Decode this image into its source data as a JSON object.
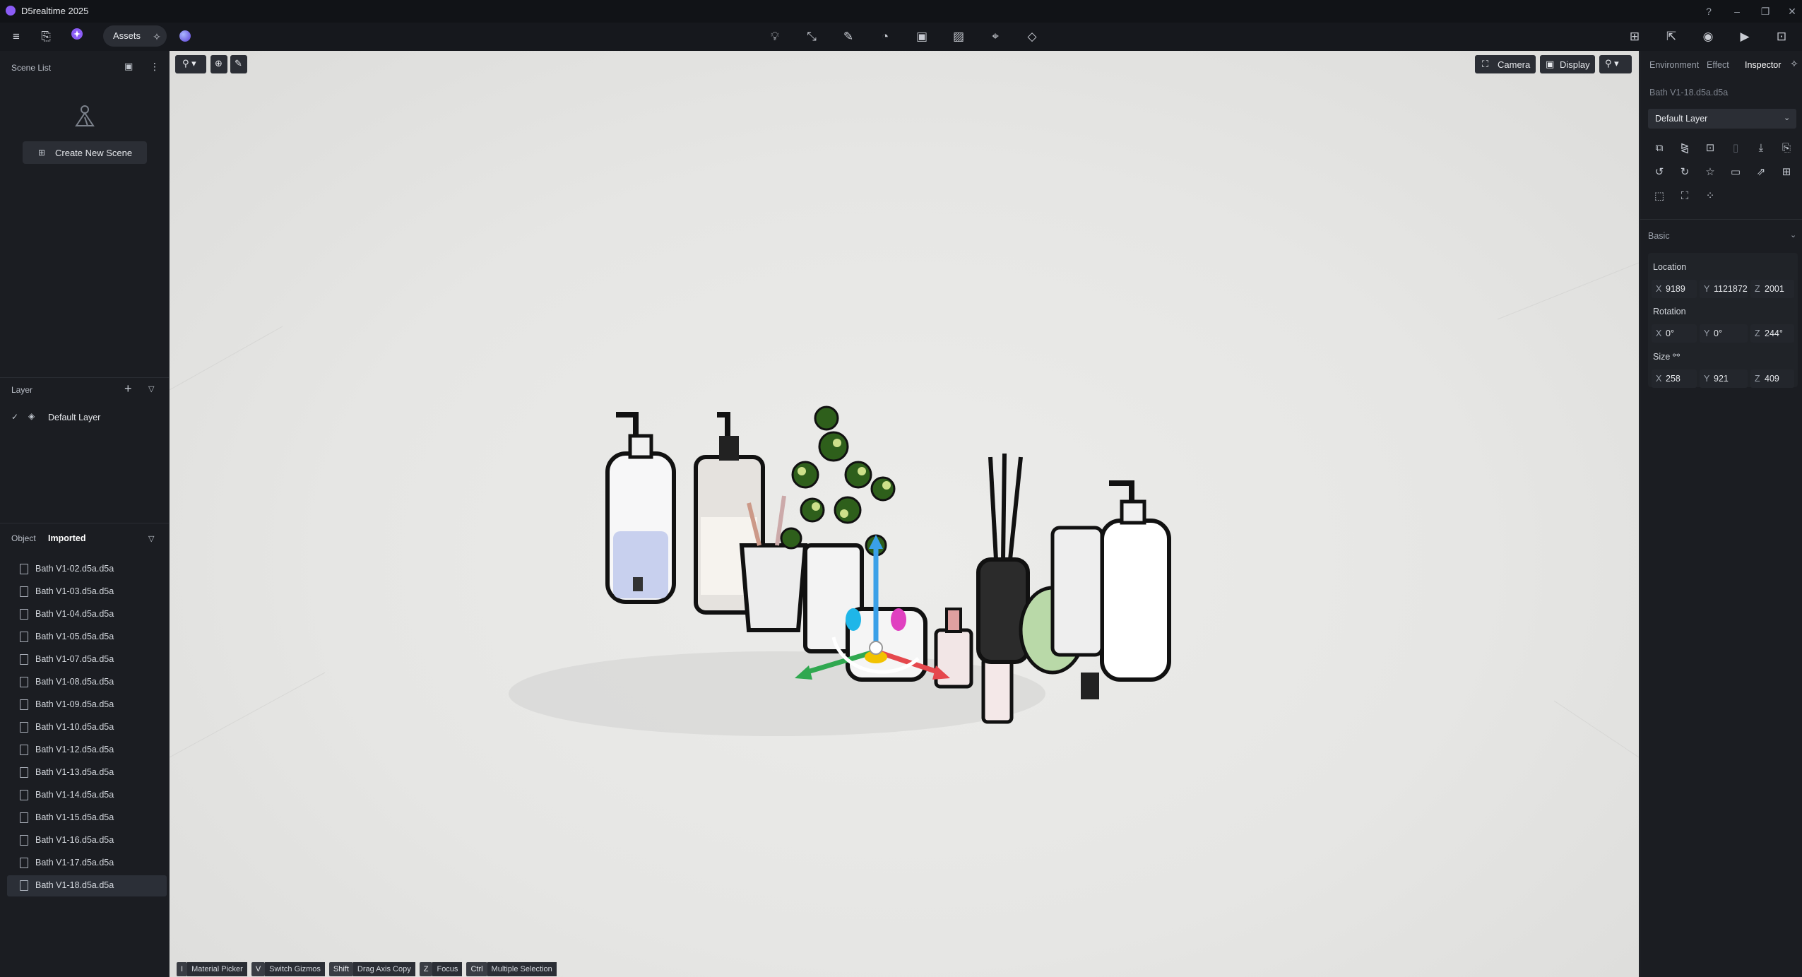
{
  "app": {
    "title": "D5realtime 2025"
  },
  "toolbar": {
    "assets_label": "Assets"
  },
  "scene_list": {
    "title": "Scene List",
    "create_label": "Create New Scene"
  },
  "layer_panel": {
    "title": "Layer",
    "items": [
      {
        "label": "Default Layer",
        "checked": true
      }
    ]
  },
  "object_panel": {
    "tabs": [
      "Object",
      "Imported"
    ],
    "active_tab": "Imported",
    "items": [
      "Bath V1-02.d5a.d5a",
      "Bath V1-03.d5a.d5a",
      "Bath V1-04.d5a.d5a",
      "Bath V1-05.d5a.d5a",
      "Bath V1-07.d5a.d5a",
      "Bath V1-08.d5a.d5a",
      "Bath V1-09.d5a.d5a",
      "Bath V1-10.d5a.d5a",
      "Bath V1-12.d5a.d5a",
      "Bath V1-13.d5a.d5a",
      "Bath V1-14.d5a.d5a",
      "Bath V1-15.d5a.d5a",
      "Bath V1-16.d5a.d5a",
      "Bath V1-17.d5a.d5a",
      "Bath V1-18.d5a.d5a"
    ],
    "selected": "Bath V1-18.d5a.d5a"
  },
  "viewport": {
    "camera_label": "Camera",
    "display_label": "Display",
    "hints": [
      {
        "key": "I",
        "label": "Material Picker"
      },
      {
        "key": "V",
        "label": "Switch Gizmos"
      },
      {
        "key": "Shift",
        "label": "Drag Axis Copy"
      },
      {
        "key": "Z",
        "label": "Focus"
      },
      {
        "key": "Ctrl",
        "label": "Multiple Selection"
      }
    ]
  },
  "inspector": {
    "tabs": [
      "Environment",
      "Effect",
      "Inspector"
    ],
    "active_tab": "Inspector",
    "object_name": "Bath V1-18.d5a.d5a",
    "layer_select": "Default Layer",
    "section": "Basic",
    "location": {
      "label": "Location",
      "x": "9189",
      "y": "1121872",
      "z": "2001"
    },
    "rotation": {
      "label": "Rotation",
      "x": "0°",
      "y": "0°",
      "z": "244°"
    },
    "size": {
      "label": "Size",
      "x": "258",
      "y": "921",
      "z": "409"
    }
  },
  "colors": {
    "accent": "#8b5cf6",
    "panel_bg": "#1b1d22",
    "viewport_bg": "#e8e8e6",
    "gizmo_x": "#e5484d",
    "gizmo_y": "#2fa84f",
    "gizmo_z": "#3aa0e8"
  }
}
